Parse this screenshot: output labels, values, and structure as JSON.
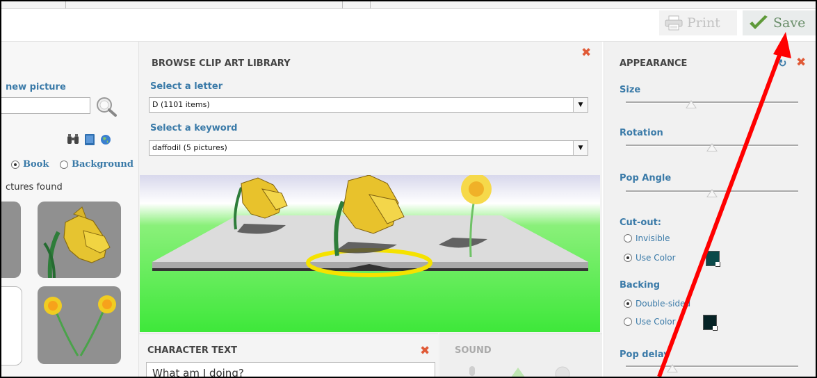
{
  "toolbar": {
    "print_label": "Print",
    "save_label": "Save"
  },
  "left_panel": {
    "new_picture_label": "new picture",
    "search_value": "",
    "radio_book": "Book",
    "radio_background": "Background",
    "results_text": "ctures found"
  },
  "clipart": {
    "title": "BROWSE CLIP ART LIBRARY",
    "letter_label": "Select a letter",
    "letter_value": "D (1101 items)",
    "keyword_label": "Select a keyword",
    "keyword_value": "daffodil (5 pictures)"
  },
  "character_text": {
    "title": "CHARACTER TEXT",
    "value": "What am I doing?"
  },
  "sound": {
    "title": "SOUND"
  },
  "appearance": {
    "title": "APPEARANCE",
    "size_label": "Size",
    "size_value": 0.38,
    "rotation_label": "Rotation",
    "rotation_value": 0.5,
    "pop_angle_label": "Pop Angle",
    "pop_angle_value": 0.5,
    "cutout_label": "Cut-out:",
    "cutout_invisible": "Invisible",
    "cutout_use_color": "Use Color",
    "cutout_color": "#0b4a4a",
    "backing_label": "Backing",
    "backing_double": "Double-sided",
    "backing_use_color": "Use Color",
    "backing_color": "#062326",
    "pop_delay_label": "Pop delay",
    "pop_delay_value": 0.27
  },
  "colors": {
    "accent_blue": "#3a7aa8",
    "close_red": "#e05a37",
    "annotation_arrow": "#ff0000"
  }
}
